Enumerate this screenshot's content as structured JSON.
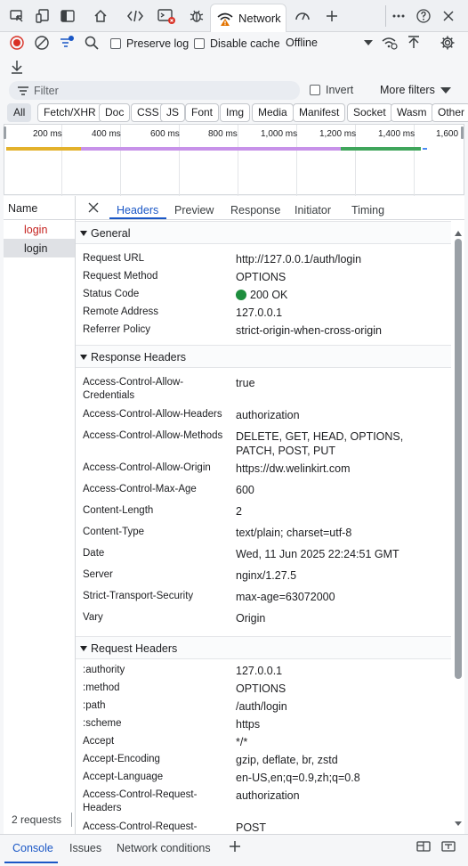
{
  "tabbar": {
    "active_tab_label": "Network",
    "icons": [
      "inspect-icon",
      "device-toggle-icon",
      "panel-layout-icon",
      "welcome-icon",
      "elements-icon",
      "console-icon",
      "sources-icon",
      "network-icon",
      "performance-icon",
      "add-icon",
      "more-icon",
      "help-icon",
      "close-icon"
    ]
  },
  "toolbar": {
    "preserve_log": "Preserve log",
    "disable_cache": "Disable cache",
    "throttling": "Offline"
  },
  "filter": {
    "placeholder": "Filter",
    "invert": "Invert",
    "more_filters": "More filters"
  },
  "type_filters": [
    "All",
    "Fetch/XHR",
    "Doc",
    "CSS",
    "JS",
    "Font",
    "Img",
    "Media",
    "Manifest",
    "Socket",
    "Wasm",
    "Other"
  ],
  "overview": {
    "ticks": [
      "200 ms",
      "400 ms",
      "600 ms",
      "800 ms",
      "1,000 ms",
      "1,200 ms",
      "1,400 ms",
      "1,600"
    ]
  },
  "requests": {
    "column": "Name",
    "items": [
      {
        "name": "login",
        "status": "error"
      },
      {
        "name": "login",
        "status": "selected"
      }
    ],
    "count": "2 requests"
  },
  "details": {
    "tabs": [
      "Headers",
      "Preview",
      "Response",
      "Initiator",
      "Timing"
    ],
    "general": {
      "title": "General",
      "rows": [
        {
          "k": "Request URL",
          "v": "http://127.0.0.1/auth/login"
        },
        {
          "k": "Request Method",
          "v": "OPTIONS"
        },
        {
          "k": "Status Code",
          "v": "200 OK"
        },
        {
          "k": "Remote Address",
          "v": "127.0.0.1"
        },
        {
          "k": "Referrer Policy",
          "v": "strict-origin-when-cross-origin"
        }
      ]
    },
    "response": {
      "title": "Response Headers",
      "rows": [
        {
          "k": "Access-Control-Allow-Credentials",
          "v": "true"
        },
        {
          "k": "Access-Control-Allow-Headers",
          "v": "authorization"
        },
        {
          "k": "Access-Control-Allow-Methods",
          "v": "DELETE, GET, HEAD, OPTIONS, PATCH, POST, PUT"
        },
        {
          "k": "Access-Control-Allow-Origin",
          "v": "https://dw.welinkirt.com"
        },
        {
          "k": "Access-Control-Max-Age",
          "v": "600"
        },
        {
          "k": "Content-Length",
          "v": "2"
        },
        {
          "k": "Content-Type",
          "v": "text/plain; charset=utf-8"
        },
        {
          "k": "Date",
          "v": "Wed, 11 Jun 2025 22:24:51 GMT"
        },
        {
          "k": "Server",
          "v": "nginx/1.27.5"
        },
        {
          "k": "Strict-Transport-Security",
          "v": "max-age=63072000"
        },
        {
          "k": "Vary",
          "v": "Origin"
        }
      ]
    },
    "request": {
      "title": "Request Headers",
      "rows": [
        {
          "k": ":authority",
          "v": "127.0.0.1"
        },
        {
          "k": ":method",
          "v": "OPTIONS"
        },
        {
          "k": ":path",
          "v": "/auth/login"
        },
        {
          "k": ":scheme",
          "v": "https"
        },
        {
          "k": "Accept",
          "v": "*/*"
        },
        {
          "k": "Accept-Encoding",
          "v": "gzip, deflate, br, zstd"
        },
        {
          "k": "Accept-Language",
          "v": "en-US,en;q=0.9,zh;q=0.8"
        },
        {
          "k": "Access-Control-Request-Headers",
          "v": "authorization"
        },
        {
          "k": "Access-Control-Request-",
          "v": "POST"
        }
      ]
    }
  },
  "drawer": {
    "tabs": [
      "Console",
      "Issues",
      "Network conditions"
    ]
  },
  "colors": {
    "accent": "#1a57c6",
    "error_text": "#c5221f",
    "status_ok": "#1e8e3e"
  }
}
